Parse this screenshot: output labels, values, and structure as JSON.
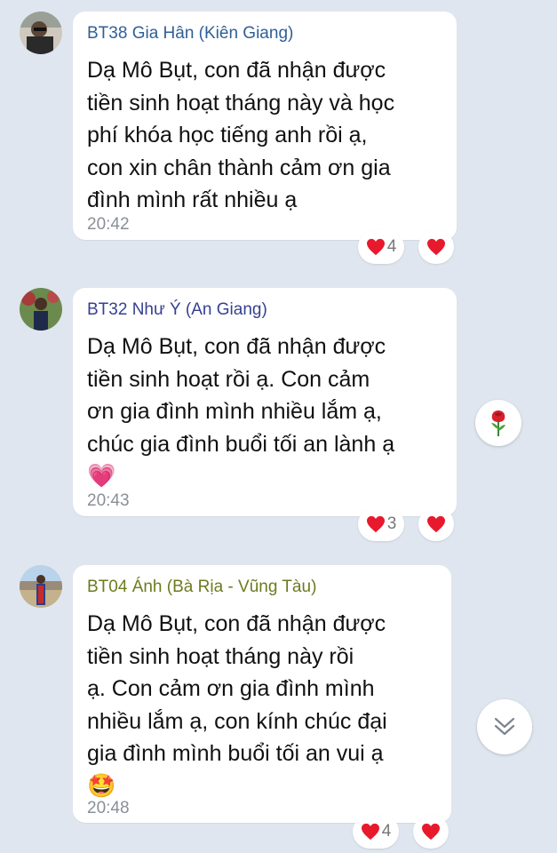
{
  "colors": {
    "background": "#dfe6ef",
    "sender_1": "#2f5f97",
    "sender_2": "#364191",
    "sender_3": "#6e7a1f",
    "heart": "#e8192c"
  },
  "messages": [
    {
      "sender": "BT38 Gia Hân (Kiên Giang)",
      "lines": [
        "Dạ Mô Bụt, con đã nhận được",
        "tiền sinh hoạt tháng này và học",
        "phí khóa học tiếng anh rồi ạ,",
        "con xin chân thành cảm ơn gia",
        "đình mình rất nhiều ạ"
      ],
      "emoji": "",
      "time": "20:42",
      "reaction_icon": "heart-icon",
      "reaction_count": "4"
    },
    {
      "sender": "BT32 Như Ý (An Giang)",
      "lines": [
        "Dạ Mô Bụt, con đã nhận được",
        "tiền sinh hoạt rồi ạ. Con cảm",
        "ơn gia đình mình nhiều lắm ạ,",
        "chúc gia đình buổi tối an lành ạ"
      ],
      "emoji": "💗",
      "time": "20:43",
      "reaction_icon": "heart-icon",
      "reaction_count": "3"
    },
    {
      "sender": "BT04 Ánh (Bà Rịa - Vũng Tàu)",
      "lines": [
        "Dạ Mô Bụt, con đã nhận được",
        "tiền sinh hoạt tháng này rồi",
        "ạ. Con cảm ơn gia đình mình",
        "nhiều lắm ạ, con kính chúc đại",
        "gia đình mình buổi tối an vui ạ"
      ],
      "emoji": "🤩",
      "time": "20:48",
      "reaction_icon": "heart-icon",
      "reaction_count": "4"
    }
  ],
  "floating": {
    "rose_icon": "rose-icon",
    "scroll_icon": "chevron-double-down-icon"
  }
}
